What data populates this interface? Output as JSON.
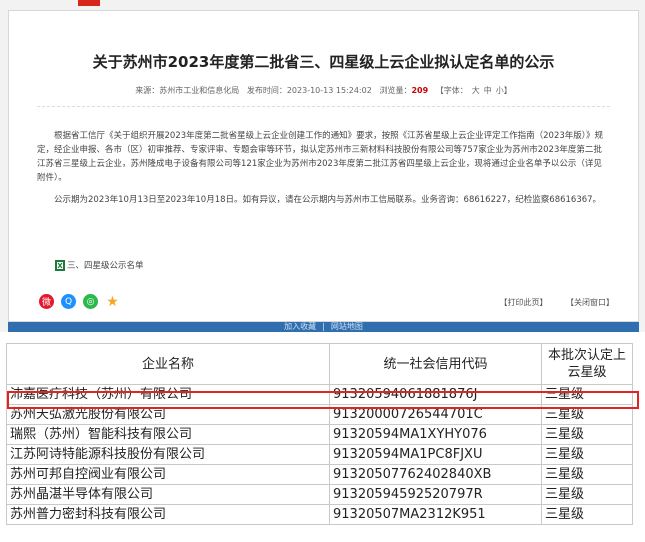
{
  "article": {
    "title": "关于苏州市2023年度第二批省三、四星级上云企业拟认定名单的公示",
    "meta": {
      "source_label": "来源：",
      "source": "苏州市工业和信息化局",
      "time_label": "发布时间：",
      "time": "2023-10-13 15:24:02",
      "views_label": "浏览量：",
      "views": "209",
      "font_label": "【字体：",
      "font_large": "大",
      "font_medium": "中",
      "font_small": "小",
      "font_close": "】"
    },
    "para1": "根据省工信厅《关于组织开展2023年度第二批省星级上云企业创建工作的通知》要求，按照《江苏省星级上云企业评定工作指南（2023年版）》规定，经企业申报、各市（区）初审推荐、专家评审、专题会审等环节，拟认定苏州市三新材料科技股份有限公司等757家企业为苏州市2023年度第二批江苏省三星级上云企业，苏州隆成电子设备有限公司等121家企业为苏州市2023年度第二批江苏省四星级上云企业，现将通过企业名单予以公示（详见附件）。",
    "para2": "公示期为2023年10月13日至2023年10月18日。如有异议，请在公示期内与苏州市工信局联系。业务咨询：68616227，纪检监察68616367。",
    "attachment": "三、四星级公示名单",
    "print_label": "【打印此页】",
    "close_label": "【关闭窗口】",
    "footer_links": [
      "加入收藏",
      "网站地图"
    ]
  },
  "share_icons": [
    {
      "name": "weibo-icon",
      "color": "#e6162d"
    },
    {
      "name": "qq-icon",
      "color": "#1e90ff"
    },
    {
      "name": "wechat-icon",
      "color": "#2db84d"
    },
    {
      "name": "star-icon",
      "color": "#f5a623"
    }
  ],
  "table": {
    "headers": [
      "企业名称",
      "统一社会信用代码",
      "本批次认定上云星级"
    ],
    "rows": [
      [
        "沛嘉医疗科技（苏州）有限公司",
        "91320594061881876J",
        "三星级"
      ],
      [
        "苏州天弘激光股份有限公司",
        "91320000726544701C",
        "三星级"
      ],
      [
        "瑞熙（苏州）智能科技有限公司",
        "91320594MA1XYHY076",
        "三星级"
      ],
      [
        "江苏阿诗特能源科技股份有限公司",
        "91320594MA1PC8FJXU",
        "三星级"
      ],
      [
        "苏州可邦自控阀业有限公司",
        "91320507762402840XB",
        "三星级"
      ],
      [
        "苏州晶湛半导体有限公司",
        "91320594592520797R",
        "三星级"
      ],
      [
        "苏州普力密封科技有限公司",
        "91320507MA2312K951",
        "三星级"
      ]
    ],
    "highlighted_row": 0,
    "highlight_color": "#e02424"
  }
}
